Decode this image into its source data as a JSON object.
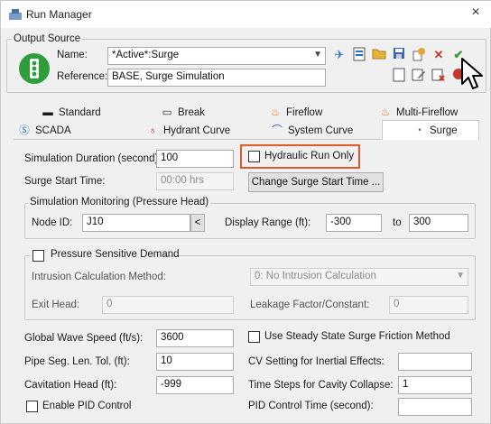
{
  "window": {
    "title": "Run Manager",
    "close_glyph": "×"
  },
  "output_source": {
    "legend": "Output Source",
    "name_label": "Name:",
    "name_value": "*Active*:Surge",
    "reference_label": "Reference:",
    "reference_value": "BASE, Surge Simulation"
  },
  "tabs_row1": [
    {
      "label": "Standard",
      "icon": "standard-icon"
    },
    {
      "label": "Break",
      "icon": "break-icon"
    },
    {
      "label": "Fireflow",
      "icon": "fireflow-icon"
    },
    {
      "label": "Multi-Fireflow",
      "icon": "multi-fireflow-icon"
    }
  ],
  "tabs_row2": [
    {
      "label": "SCADA",
      "icon": "scada-icon"
    },
    {
      "label": "Hydrant Curve",
      "icon": "hydrant-curve-icon"
    },
    {
      "label": "System Curve",
      "icon": "system-curve-icon"
    },
    {
      "label": "Surge",
      "icon": "surge-icon",
      "active": true
    }
  ],
  "surge": {
    "sim_duration_label": "Simulation Duration (second):",
    "sim_duration_value": "100",
    "hydraulic_run_only_label": "Hydraulic Run Only",
    "surge_start_time_label": "Surge Start Time:",
    "surge_start_time_value": "00:00 hrs",
    "change_start_time_button": "Change Surge Start Time ...",
    "monitoring": {
      "legend": "Simulation Monitoring (Pressure Head)",
      "node_id_label": "Node ID:",
      "node_id_value": "J10",
      "node_btn": "<",
      "display_range_label": "Display Range (ft):",
      "range_from": "-300",
      "to_label": "to",
      "range_to": "300"
    },
    "pressure_demand": {
      "legend": "Pressure Sensitive Demand",
      "intrusion_method_label": "Intrusion Calculation Method:",
      "intrusion_method_value": "0: No Intrusion Calculation",
      "exit_head_label": "Exit Head:",
      "exit_head_value": "0",
      "leakage_label": "Leakage Factor/Constant:",
      "leakage_value": "0"
    },
    "global_wave_speed_label": "Global Wave Speed (ft/s):",
    "global_wave_speed_value": "3600",
    "steady_state_friction_label": "Use Steady State Surge Friction Method",
    "pipe_seg_tol_label": "Pipe Seg. Len. Tol. (ft):",
    "pipe_seg_tol_value": "10",
    "cv_setting_label": "CV Setting for Inertial Effects:",
    "cv_setting_value": "",
    "cavitation_head_label": "Cavitation Head (ft):",
    "cavitation_head_value": "-999",
    "time_steps_label": "Time Steps for Cavity Collapse:",
    "time_steps_value": "1",
    "enable_pid_label": "Enable PID Control",
    "pid_time_label": "PID Control Time (second):",
    "pid_time_value": ""
  },
  "colors": {
    "highlight": "#e05a2b",
    "run_icon_green": "#2e9e3a",
    "tab_active_bg": "#ffffff"
  }
}
